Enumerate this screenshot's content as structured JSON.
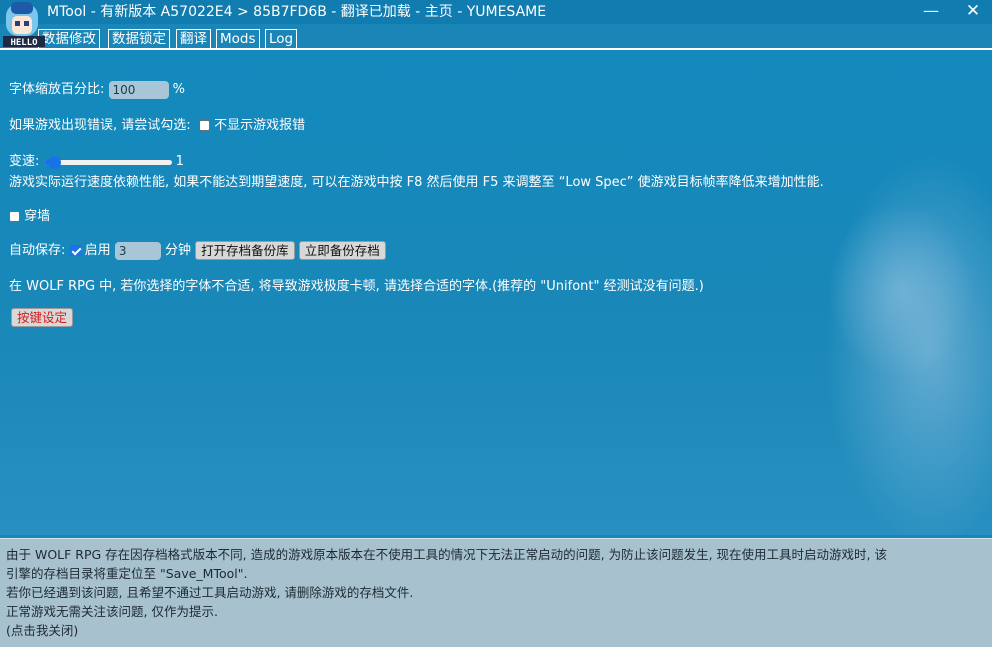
{
  "window": {
    "title": "MTool - 有新版本 A57022E4 > 85B7FD6B - 翻译已加载 - 主页 - YUMESAME",
    "logo_text": "HELLO",
    "minimize_glyph": "—",
    "close_glyph": "✕"
  },
  "tabs": [
    {
      "label": "数据修改"
    },
    {
      "label": "数据锁定"
    },
    {
      "label": "翻译"
    },
    {
      "label": "Mods"
    },
    {
      "label": "Log"
    }
  ],
  "settings": {
    "font_scale": {
      "label": "字体缩放百分比:",
      "value": "100",
      "unit": "%"
    },
    "hide_errors": {
      "label": "如果游戏出现错误, 请尝试勾选:",
      "checkbox_label": "不显示游戏报错",
      "checked": false
    },
    "speed": {
      "label": "变速:",
      "value": "1",
      "slider_fraction": 0.0,
      "hint": "游戏实际运行速度依赖性能, 如果不能达到期望速度, 可以在游戏中按 F8 然后使用 F5 来调整至 “Low Spec” 使游戏目标帧率降低来增加性能."
    },
    "wall_pass": {
      "label": "穿墙",
      "checked": false
    },
    "autosave": {
      "label": "自动保存:",
      "enabled_label": "启用",
      "enabled": true,
      "minutes": "3",
      "minutes_unit": "分钟",
      "open_backup_label": "打开存档备份库",
      "backup_now_label": "立即备份存档"
    },
    "wolf_font_note": "在 WOLF RPG 中, 若你选择的字体不合适, 将导致游戏极度卡顿, 请选择合适的字体.(推荐的 \"Unifont\" 经测试没有问题.)",
    "keybind_label": "按键设定"
  },
  "notice": {
    "line1": "由于 WOLF RPG 存在因存档格式版本不同, 造成的游戏原本版本在不使用工具的情况下无法正常启动的问题, 为防止该问题发生, 现在使用工具时启动游戏时, 该",
    "line2": "引擎的存档目录将重定位至 \"Save_MTool\".",
    "line3": "若你已经遇到该问题, 且希望不通过工具启动游戏, 请删除游戏的存档文件.",
    "line4": "正常游戏无需关注该问题, 仅作为提示.",
    "line5": "(点击我关闭)"
  },
  "colors": {
    "background": "#1a86b8",
    "titlebar": "#107cb0",
    "notice_bg": "#a7c1cf",
    "accent": "#1a72e8",
    "keybind_text": "#d91a1a"
  }
}
